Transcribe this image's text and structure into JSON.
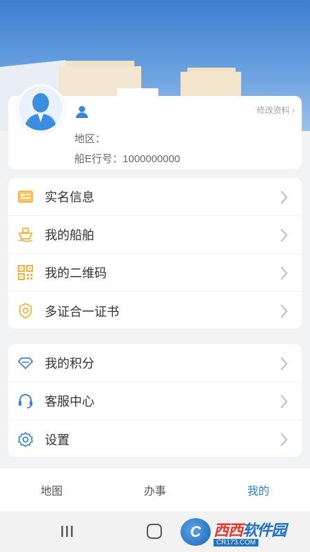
{
  "colors": {
    "accent": "#2f7fd2",
    "menu_icon_yellow": "#f2b13d",
    "menu_icon_blue": "#3a86d6"
  },
  "profile": {
    "edit_label": "修改资料",
    "region_label": "地区：",
    "ship_id_label": "船E行号：1000000000"
  },
  "menu_group_1": [
    {
      "label": "实名信息",
      "icon": "id-card-icon"
    },
    {
      "label": "我的船舶",
      "icon": "ship-icon"
    },
    {
      "label": "我的二维码",
      "icon": "qrcode-icon"
    },
    {
      "label": "多证合一证书",
      "icon": "certificate-icon"
    }
  ],
  "menu_group_2": [
    {
      "label": "我的积分",
      "icon": "diamond-icon"
    },
    {
      "label": "客服中心",
      "icon": "headset-icon"
    },
    {
      "label": "设置",
      "icon": "gear-icon"
    }
  ],
  "tabbar": {
    "tabs": [
      "地图",
      "办事",
      "我的"
    ],
    "active_index": 2
  },
  "watermark": {
    "main_left": "西西",
    "main_right": "软件园",
    "sub": "CR173.COM"
  }
}
